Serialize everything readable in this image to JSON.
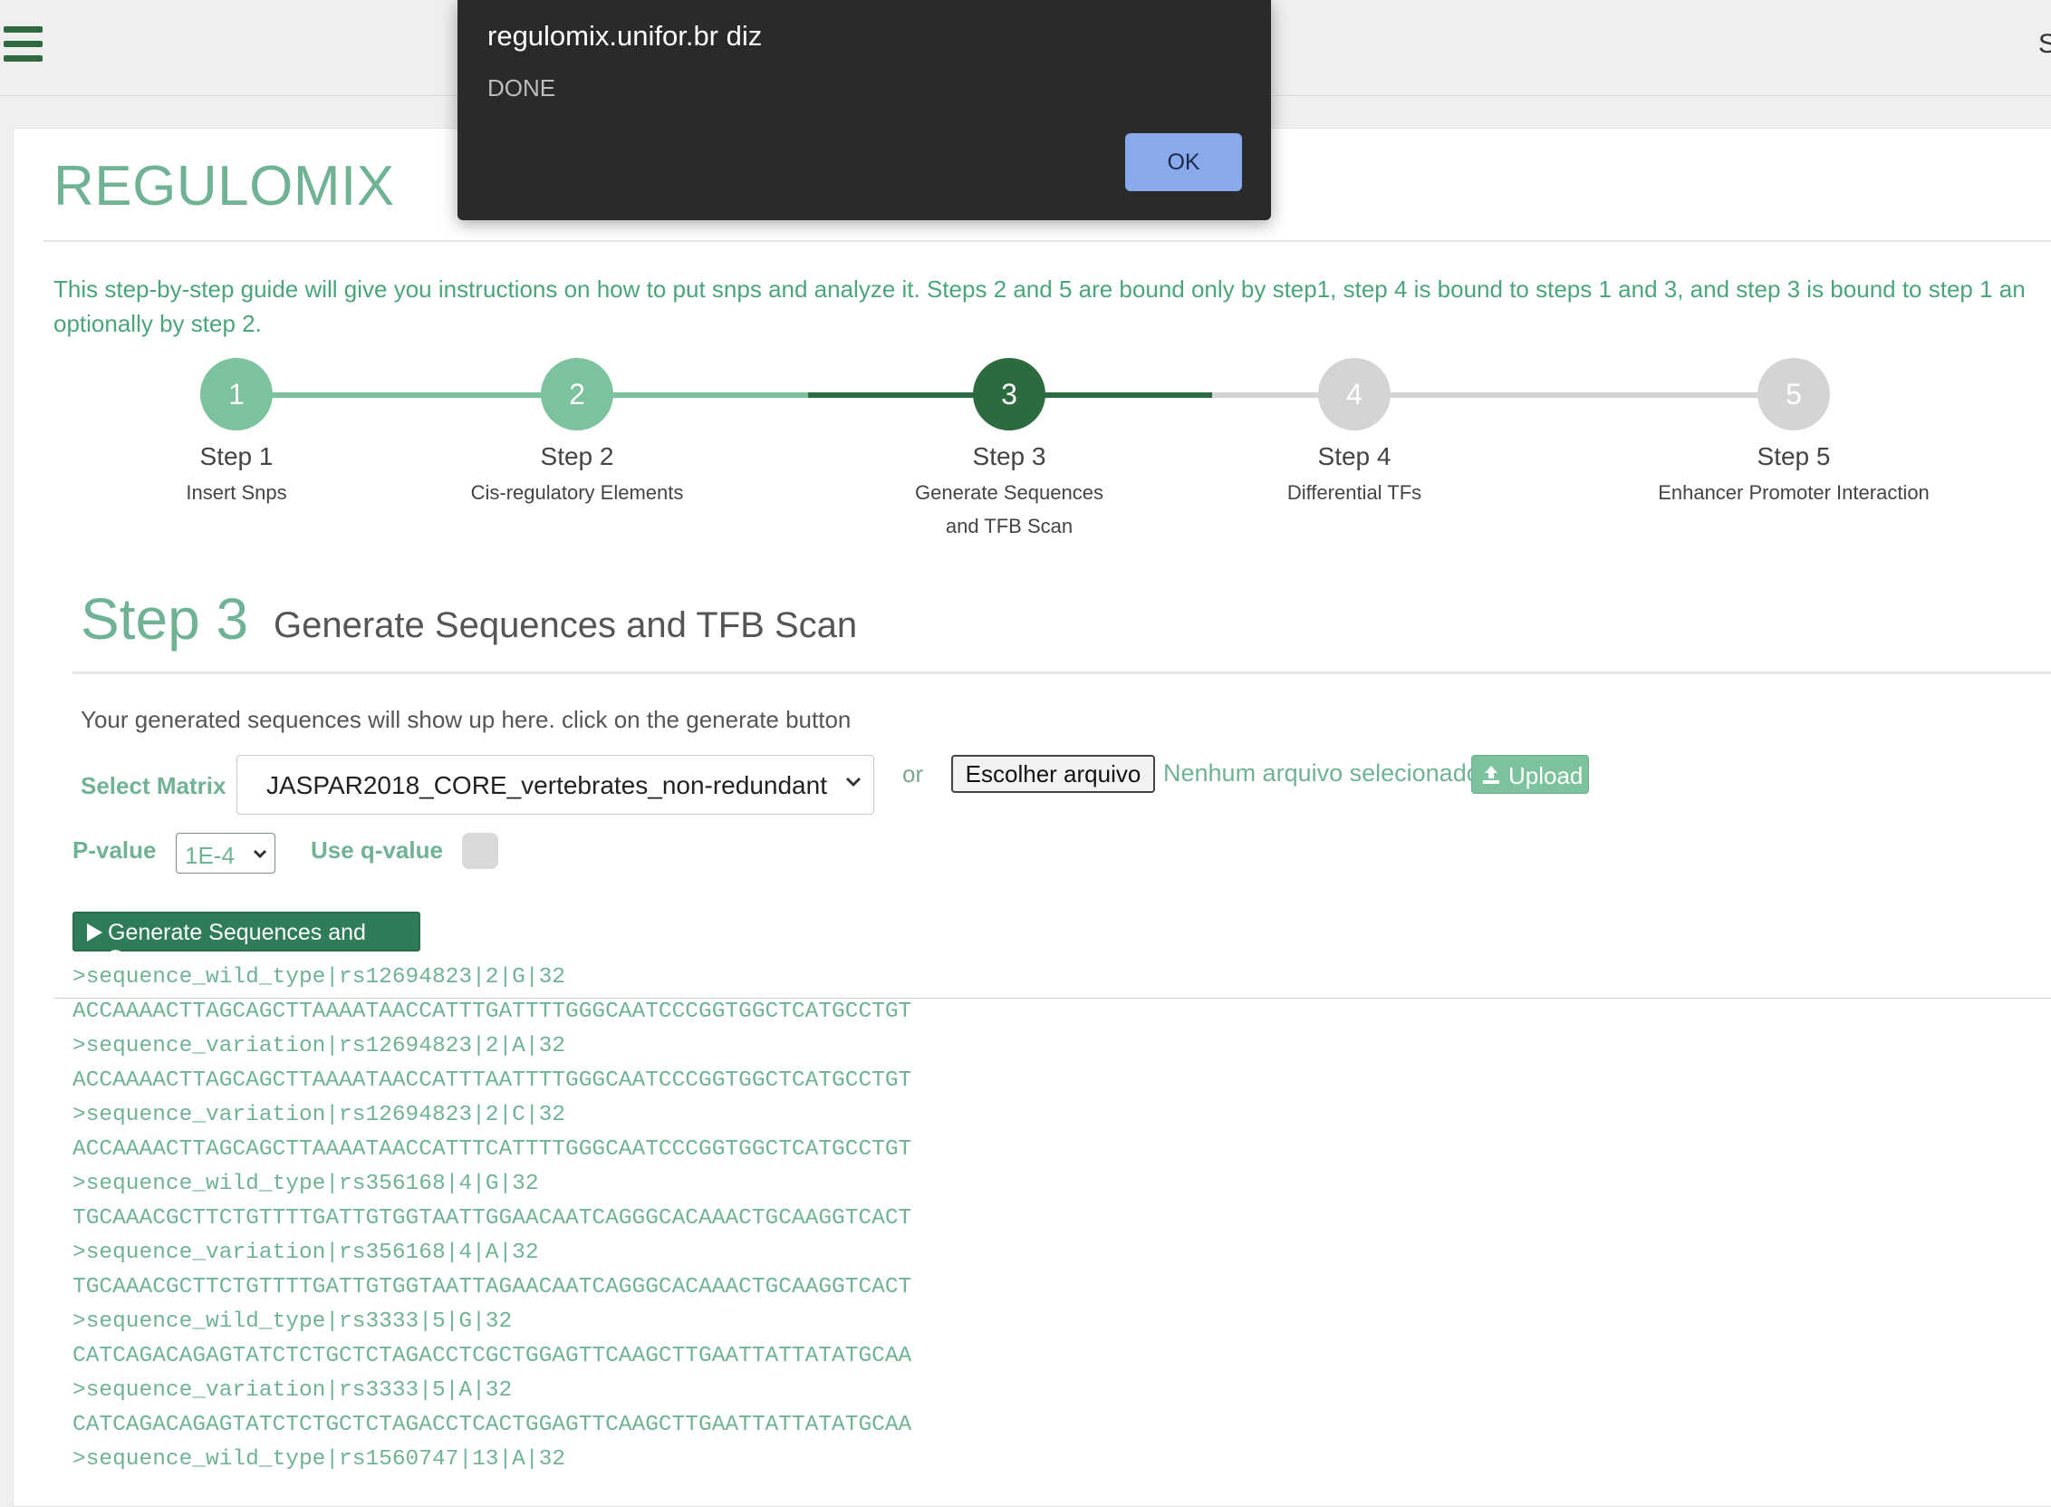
{
  "nav": {
    "right_fragment": "S"
  },
  "brand": {
    "title": "REGULOMIX"
  },
  "intro": {
    "line1": "This step-by-step guide will give you instructions on how to put snps and analyze it. Steps 2 and 5 are bound only by step1, step 4 is bound to steps 1 and 3, and step 3 is bound to step 1 an",
    "line2": "optionally by step 2."
  },
  "stepper": {
    "steps": [
      {
        "number": "1",
        "title": "Step 1",
        "sub1": "Insert Snps",
        "sub2": "",
        "state": "done"
      },
      {
        "number": "2",
        "title": "Step 2",
        "sub1": "Cis-regulatory Elements",
        "sub2": "",
        "state": "done"
      },
      {
        "number": "3",
        "title": "Step 3",
        "sub1": "Generate Sequences",
        "sub2": "and TFB Scan",
        "state": "active"
      },
      {
        "number": "4",
        "title": "Step 4",
        "sub1": "Differential TFs",
        "sub2": "",
        "state": "todo"
      },
      {
        "number": "5",
        "title": "Step 5",
        "sub1": "Enhancer Promoter Interaction",
        "sub2": "",
        "state": "todo"
      }
    ],
    "colors": {
      "done": "#7cc29c",
      "active": "#2c6a3f",
      "todo": "#d4d4d4"
    }
  },
  "section": {
    "title": "Step 3",
    "subtitle": "Generate Sequences and TFB Scan",
    "info": "Your generated sequences will show up here. click on the generate button"
  },
  "form": {
    "matrix_label": "Select Matrix",
    "matrix_value": "JASPAR2018_CORE_vertebrates_non-redundant",
    "or_text": "or",
    "file_button": "Escolher arquivo",
    "no_file": "Nenhum arquivo selecionado",
    "upload_button": "Upload",
    "pvalue_label": "P-value",
    "pvalue_value": "1E-4",
    "qvalue_label": "Use q-value",
    "qvalue_checked": false,
    "generate_button": "Generate Sequences and Scan"
  },
  "output": {
    "lines": [
      ">sequence_wild_type|rs12694823|2|G|32",
      "ACCAAAACTTAGCAGCTTAAAATAACCATTTGATTTTGGGCAATCCCGGTGGCTCATGCCTGT",
      ">sequence_variation|rs12694823|2|A|32",
      "ACCAAAACTTAGCAGCTTAAAATAACCATTTAATTTTGGGCAATCCCGGTGGCTCATGCCTGT",
      ">sequence_variation|rs12694823|2|C|32",
      "ACCAAAACTTAGCAGCTTAAAATAACCATTTCATTTTGGGCAATCCCGGTGGCTCATGCCTGT",
      ">sequence_wild_type|rs356168|4|G|32",
      "TGCAAACGCTTCTGTTTTGATTGTGGTAATTGGAACAATCAGGGCACAAACTGCAAGGTCACT",
      ">sequence_variation|rs356168|4|A|32",
      "TGCAAACGCTTCTGTTTTGATTGTGGTAATTAGAACAATCAGGGCACAAACTGCAAGGTCACT",
      ">sequence_wild_type|rs3333|5|G|32",
      "CATCAGACAGAGTATCTCTGCTCTAGACCTCGCTGGAGTTCAAGCTTGAATTATTATATGCAA",
      ">sequence_variation|rs3333|5|A|32",
      "CATCAGACAGAGTATCTCTGCTCTAGACCTCACTGGAGTTCAAGCTTGAATTATTATATGCAA",
      ">sequence_wild_type|rs1560747|13|A|32"
    ]
  },
  "dialog": {
    "title": "regulomix.unifor.br diz",
    "message": "DONE",
    "ok_button": "OK"
  }
}
